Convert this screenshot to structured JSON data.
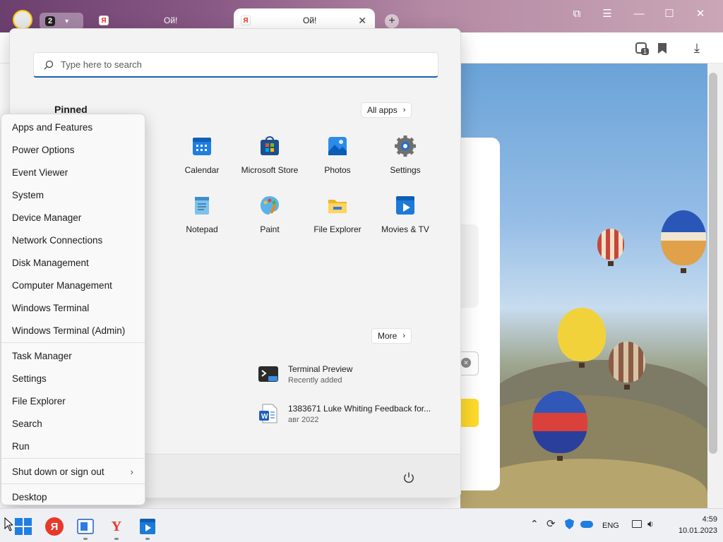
{
  "browser": {
    "tabs": [
      {
        "title": "Ой!"
      },
      {
        "title": "Ой!"
      }
    ],
    "tab_count_badge": "2",
    "notifications_badge": "1"
  },
  "start_menu": {
    "search_placeholder": "Type here to search",
    "pinned_title": "Pinned",
    "all_apps_label": "All apps",
    "more_label": "More",
    "pinned_apps": [
      {
        "label": "Calendar"
      },
      {
        "label": "Microsoft Store"
      },
      {
        "label": "Photos"
      },
      {
        "label": "Settings"
      },
      {
        "label": "Notepad"
      },
      {
        "label": "Paint"
      },
      {
        "label": "File Explorer"
      },
      {
        "label": "Movies & TV"
      }
    ],
    "recommended": [
      {
        "title": "Terminal Preview",
        "subtitle": "Recently added"
      },
      {
        "title": "1383671 Luke Whiting Feedback for...",
        "subtitle": "авг 2022"
      }
    ]
  },
  "context_menu": {
    "group1": [
      "Apps and Features",
      "Power Options",
      "Event Viewer",
      "System",
      "Device Manager",
      "Network Connections",
      "Disk Management",
      "Computer Management",
      "Windows Terminal",
      "Windows Terminal (Admin)"
    ],
    "group2": [
      "Task Manager",
      "Settings",
      "File Explorer",
      "Search",
      "Run"
    ],
    "shutdown_label": "Shut down or sign out",
    "desktop_label": "Desktop"
  },
  "taskbar": {
    "language": "ENG",
    "time": "4:59",
    "date": "10.01.2023"
  },
  "colors": {
    "accent": "#1a5fb4",
    "yandex_red": "#e8382a"
  }
}
